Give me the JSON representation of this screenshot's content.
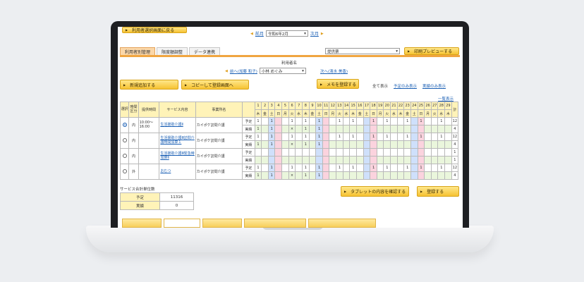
{
  "header": {
    "back_label": "利用者選択画面に戻る",
    "prev_month": "前月",
    "month_value": "令和6年2月",
    "next_month": "次月"
  },
  "tabs": [
    {
      "label": "利用者別管理",
      "active": true
    },
    {
      "label": "限度額調整",
      "active": false
    },
    {
      "label": "データ連携",
      "active": false
    }
  ],
  "report": {
    "value": "提供票",
    "print_label": "印刷プレビューする"
  },
  "user": {
    "label": "利用者名",
    "prev": "前へ(加藤 和子)",
    "current": "小林 めぐみ",
    "next": "次へ(清水 美香)"
  },
  "actions": {
    "add": "新規追加する",
    "copy": "コピーして登録画面へ",
    "memo": "メモを登録する",
    "show_all": "全て表示",
    "show_plan": "予定のみ表示",
    "show_actual": "実績のみ表示",
    "list_view": "一覧表示",
    "tablet": "タブレットの内容を確認する",
    "register": "登録する"
  },
  "table": {
    "headers": {
      "select": "選択",
      "category": "時間区分",
      "time": "提供時間",
      "service": "サービス内容",
      "office": "事業所名",
      "total": "計"
    },
    "days": [
      "1",
      "2",
      "3",
      "4",
      "5",
      "6",
      "7",
      "8",
      "9",
      "10",
      "11",
      "12",
      "13",
      "14",
      "15",
      "16",
      "17",
      "18",
      "19",
      "20",
      "21",
      "22",
      "23",
      "24",
      "25",
      "26",
      "27",
      "28",
      "29"
    ],
    "weekdays": [
      "木",
      "金",
      "土",
      "日",
      "月",
      "火",
      "水",
      "木",
      "金",
      "土",
      "日",
      "月",
      "火",
      "水",
      "木",
      "金",
      "土",
      "日",
      "月",
      "火",
      "水",
      "木",
      "金",
      "土",
      "日",
      "月",
      "火",
      "水",
      "木"
    ],
    "rows": [
      {
        "selected": true,
        "category": "内",
        "time": "10:00～\n16:00",
        "service": "生活援助介護Ⅱ",
        "office": "カイポケ訪問介護",
        "plan_label": "予定",
        "actual_label": "実績",
        "plan": [
          "1",
          "",
          "1",
          "",
          "",
          "1",
          "",
          "1",
          "",
          "1",
          "",
          "",
          "1",
          "",
          "1",
          "",
          "",
          "1",
          "",
          "1",
          "",
          "",
          "1",
          "",
          "1",
          "",
          "",
          "1",
          ""
        ],
        "actual": [
          "1",
          "",
          "1",
          "",
          "",
          "×",
          "",
          "1",
          "",
          "1",
          "",
          "",
          "",
          "",
          "",
          "",
          "",
          "",
          "",
          "",
          "",
          "",
          "",
          "",
          "",
          "",
          "",
          "",
          ""
        ],
        "plan_total": "12",
        "actual_total": "4"
      },
      {
        "selected": false,
        "category": "内",
        "time": "",
        "service": "生活援助介護Ⅲ訪問介護時間加算１",
        "office": "カイポケ訪問介護",
        "plan_label": "予定",
        "actual_label": "実績",
        "plan": [
          "1",
          "",
          "1",
          "",
          "",
          "1",
          "",
          "1",
          "",
          "1",
          "",
          "",
          "1",
          "",
          "1",
          "",
          "",
          "1",
          "",
          "1",
          "",
          "",
          "1",
          "",
          "1",
          "",
          "",
          "1",
          ""
        ],
        "actual": [
          "1",
          "",
          "1",
          "",
          "",
          "×",
          "",
          "1",
          "",
          "1",
          "",
          "",
          "",
          "",
          "",
          "",
          "",
          "",
          "",
          "",
          "",
          "",
          "",
          "",
          "",
          "",
          "",
          "",
          ""
        ],
        "plan_total": "12",
        "actual_total": "4"
      },
      {
        "selected": false,
        "category": "内",
        "time": "",
        "service": "生活援助介護Ⅲ緊急時加算Ⅱ",
        "office": "カイポケ訪問介護",
        "plan_label": "予定",
        "actual_label": "実績",
        "plan": [
          "",
          "",
          "",
          "",
          "",
          "",
          "",
          "",
          "",
          "",
          "",
          "",
          "",
          "",
          "",
          "",
          "",
          "",
          "",
          "",
          "",
          "",
          "",
          "",
          "",
          "",
          "",
          "",
          ""
        ],
        "actual": [
          "",
          "",
          "",
          "",
          "",
          "",
          "",
          "",
          "",
          "",
          "",
          "",
          "",
          "",
          "",
          "",
          "",
          "",
          "",
          "",
          "",
          "",
          "",
          "",
          "",
          "",
          "",
          "",
          ""
        ],
        "plan_total": "1",
        "actual_total": "1"
      },
      {
        "selected": false,
        "category": "外",
        "time": "",
        "service": "おむつ",
        "office": "カイポケ訪問介護",
        "plan_label": "予定",
        "actual_label": "実績",
        "plan": [
          "1",
          "",
          "1",
          "",
          "",
          "1",
          "",
          "1",
          "",
          "1",
          "",
          "",
          "1",
          "",
          "1",
          "",
          "",
          "1",
          "",
          "1",
          "",
          "",
          "1",
          "",
          "1",
          "",
          "",
          "1",
          ""
        ],
        "actual": [
          "1",
          "",
          "1",
          "",
          "",
          "×",
          "",
          "1",
          "",
          "1",
          "",
          "",
          "",
          "",
          "",
          "",
          "",
          "",
          "",
          "",
          "",
          "",
          "",
          "",
          "",
          "",
          "",
          "",
          ""
        ],
        "plan_total": "12",
        "actual_total": "4"
      }
    ]
  },
  "summary": {
    "title": "サービス合計単位数",
    "plan_label": "予定",
    "plan_value": "11316",
    "actual_label": "実績",
    "actual_value": "0"
  }
}
